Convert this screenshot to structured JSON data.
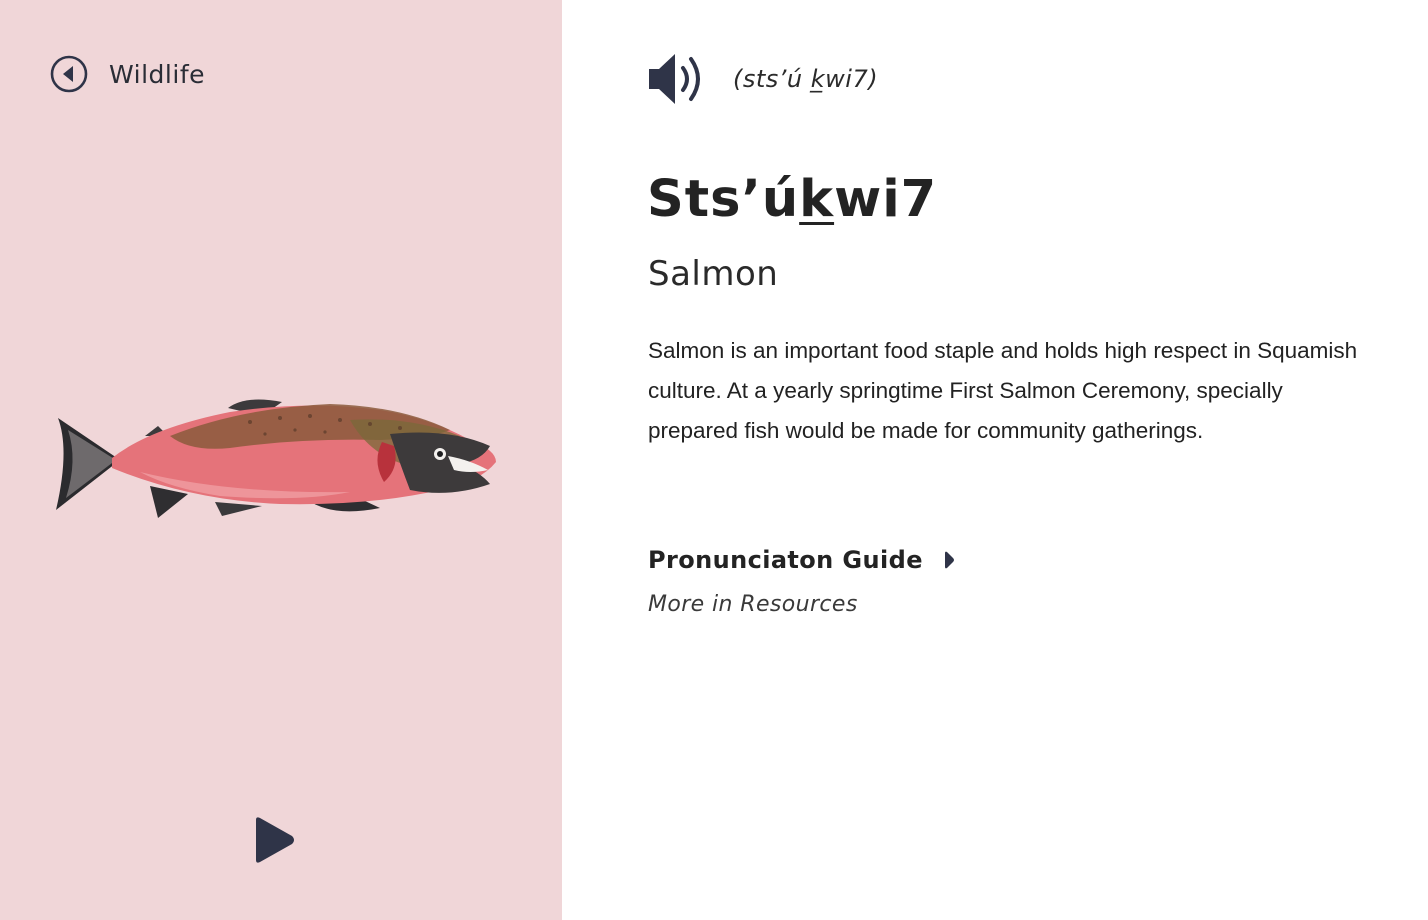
{
  "nav": {
    "back_label": "Wildlife"
  },
  "entry": {
    "phonetic": "(sts’ú k̲wi7)",
    "title_parts": [
      "Sts’ú",
      "k",
      "wi7"
    ],
    "translation": "Salmon",
    "description": "Salmon is an important food staple and holds high respect in Squamish culture. At a yearly springtime First Salmon Ceremony, specially prepared fish would be made for community gatherings."
  },
  "guide": {
    "label": "Pronunciaton Guide",
    "resources": "More in Resources"
  },
  "icons": {
    "back": "circle-arrow-left-icon",
    "play": "play-icon",
    "speaker": "speaker-icon",
    "caret": "caret-right-icon",
    "illustration": "salmon-illustration"
  },
  "colors": {
    "panel_background": "#f0d6d8",
    "icon_dark": "#2f3448",
    "fish_body": "#e5737a"
  }
}
